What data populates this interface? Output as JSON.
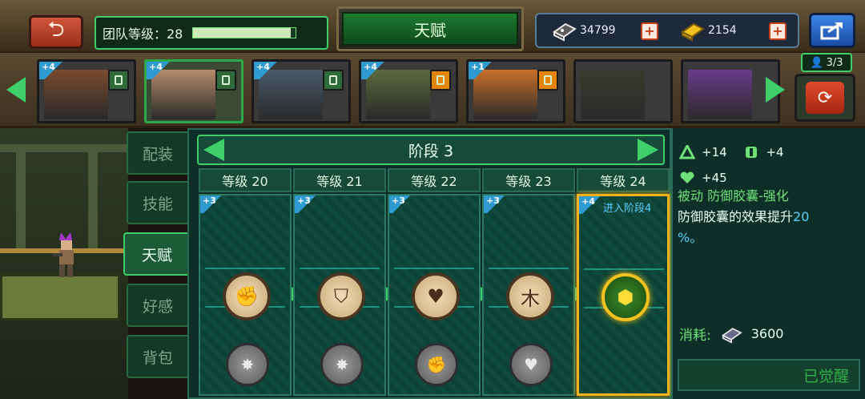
{
  "header": {
    "team_level_label": "团队等级：28",
    "team_level_progress": 0.95,
    "title": "天赋",
    "currency_dark_value": "34799",
    "currency_gold_value": "2154"
  },
  "roster": {
    "count_label": "3/3",
    "heroes": [
      {
        "badge": "+4",
        "role": "green",
        "selected": false,
        "color": "#7a4a2e"
      },
      {
        "badge": "+4",
        "role": "green",
        "selected": true,
        "color": "#b58c6a"
      },
      {
        "badge": "+4",
        "role": "green",
        "selected": false,
        "color": "#4a5a6a"
      },
      {
        "badge": "+4",
        "role": "orange",
        "selected": false,
        "color": "#5a6a3a"
      },
      {
        "badge": "+1",
        "role": "orange",
        "selected": false,
        "color": "#c8702a"
      },
      {
        "badge": "",
        "role": "",
        "selected": false,
        "color": "#3a3a2e"
      },
      {
        "badge": "",
        "role": "",
        "selected": false,
        "color": "#6a3a8a"
      }
    ]
  },
  "tabs": [
    {
      "label": "配装",
      "active": false
    },
    {
      "label": "技能",
      "active": false
    },
    {
      "label": "天赋",
      "active": true
    },
    {
      "label": "好感",
      "active": false
    },
    {
      "label": "背包",
      "active": false
    }
  ],
  "stage": {
    "title": "阶段 3",
    "columns": [
      {
        "head": "等级 20",
        "badge": "+3",
        "glyph": "✊",
        "dim_glyph": "✸",
        "active": false,
        "enter": ""
      },
      {
        "head": "等级 21",
        "badge": "+3",
        "glyph": "⛉",
        "dim_glyph": "✸",
        "active": false,
        "enter": ""
      },
      {
        "head": "等级 22",
        "badge": "+3",
        "glyph": "♥",
        "dim_glyph": "✊",
        "active": false,
        "enter": ""
      },
      {
        "head": "等级 23",
        "badge": "+3",
        "glyph": "⽊",
        "dim_glyph": "♥",
        "active": false,
        "enter": ""
      },
      {
        "head": "等级 24",
        "badge": "+4",
        "glyph": "⬢",
        "dim_glyph": "",
        "active": true,
        "enter": "进入阶段4"
      }
    ]
  },
  "info": {
    "stat1": "+14",
    "stat2": "+4",
    "stat3": "+45",
    "skill_name": "被动 防御胶囊-强化",
    "skill_desc_a": "防御胶囊的效果提升",
    "skill_desc_num": "20",
    "skill_desc_b": "%。",
    "cost_label": "消耗:",
    "cost_value": "3600",
    "awake_label": "已觉醒"
  },
  "colors": {
    "accent_green": "#3fcf6a",
    "active_gold": "#f2b21e",
    "highlight_blue": "#5ad0ff"
  }
}
